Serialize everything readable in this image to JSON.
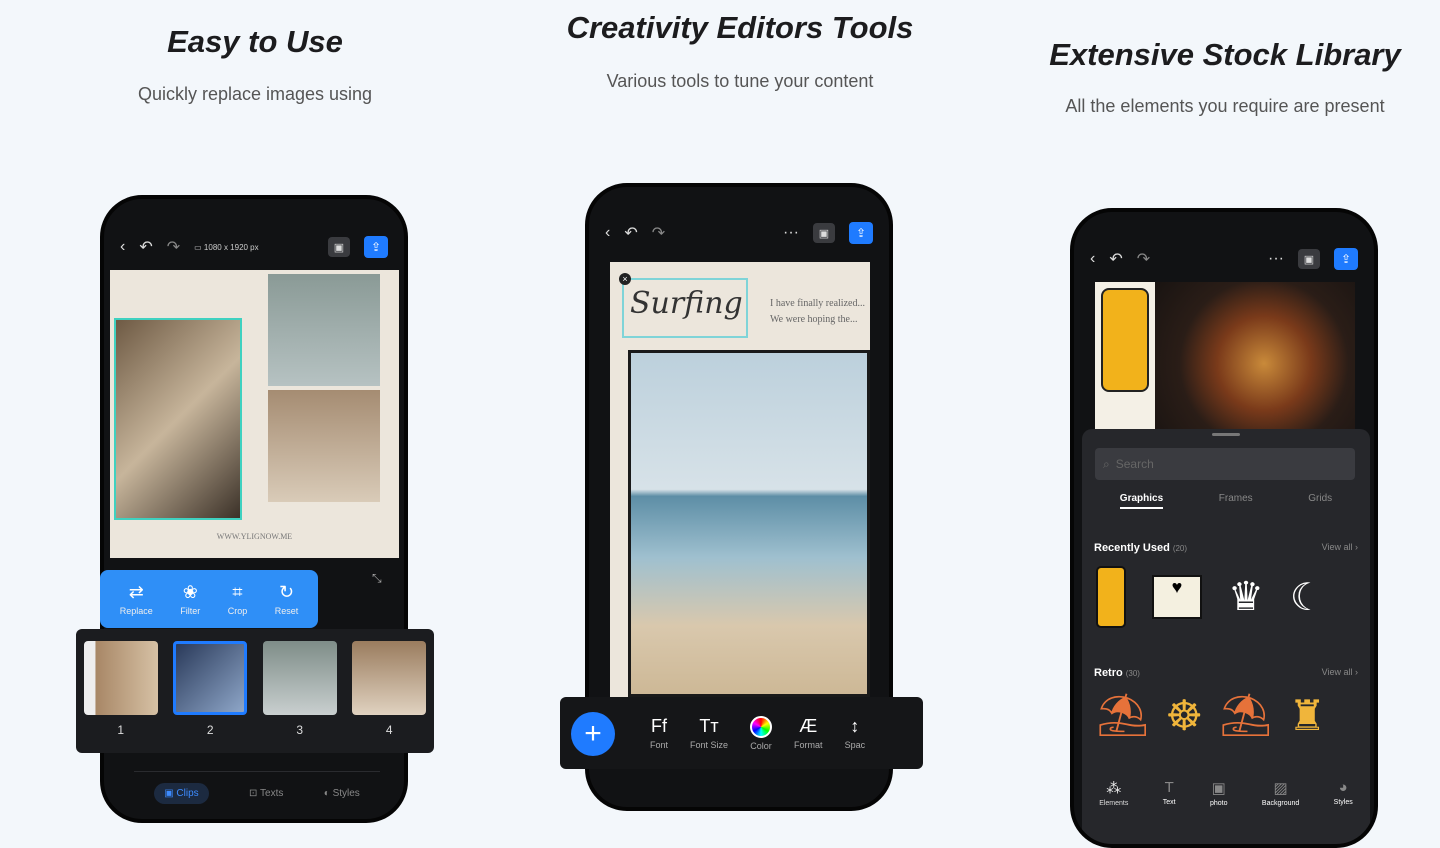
{
  "sections": [
    {
      "title": "Easy to Use",
      "subtitle": "Quickly replace images using"
    },
    {
      "title": "Creativity Editors Tools",
      "subtitle": "Various tools to tune your content"
    },
    {
      "title": "Extensive Stock Library",
      "subtitle": "All the elements you require are present"
    }
  ],
  "left_phone": {
    "canvas_size": "1080 x 1920 px",
    "canvas_footer": "WWW.YLIGNOW.ME",
    "tools": [
      {
        "label": "Replace",
        "icon": "replace-icon"
      },
      {
        "label": "Filter",
        "icon": "filter-icon"
      },
      {
        "label": "Crop",
        "icon": "crop-icon"
      },
      {
        "label": "Reset",
        "icon": "reset-icon"
      }
    ],
    "clips": [
      "1",
      "2",
      "3",
      "4"
    ],
    "selected_clip": "2",
    "tabs": [
      {
        "label": "Clips",
        "active": true
      },
      {
        "label": "Texts"
      },
      {
        "label": "Styles"
      }
    ]
  },
  "middle_phone": {
    "more": "···",
    "headline": "Surfing",
    "body_text": "I have finally realized... We were hoping the...",
    "tools": [
      {
        "label": "Font",
        "glyph": "Ff"
      },
      {
        "label": "Font Size",
        "glyph": "Tт"
      },
      {
        "label": "Color",
        "glyph": ""
      },
      {
        "label": "Format",
        "glyph": "Æ"
      },
      {
        "label": "Spac",
        "glyph": "↕"
      }
    ],
    "add_glyph": "+"
  },
  "right_phone": {
    "more": "···",
    "search_placeholder": "Search",
    "tabs": [
      {
        "label": "Graphics",
        "active": true
      },
      {
        "label": "Frames"
      },
      {
        "label": "Grids"
      }
    ],
    "recent": {
      "title": "Recently Used",
      "count": "(20)",
      "view_all": "View all"
    },
    "retro": {
      "title": "Retro",
      "count": "(30)",
      "view_all": "View all"
    },
    "nav": [
      "Elements",
      "Text",
      "photo",
      "Background",
      "Styles"
    ]
  },
  "colors": {
    "accent": "#1f7bff",
    "background": "#f3f7fb",
    "phone": "#111214"
  }
}
